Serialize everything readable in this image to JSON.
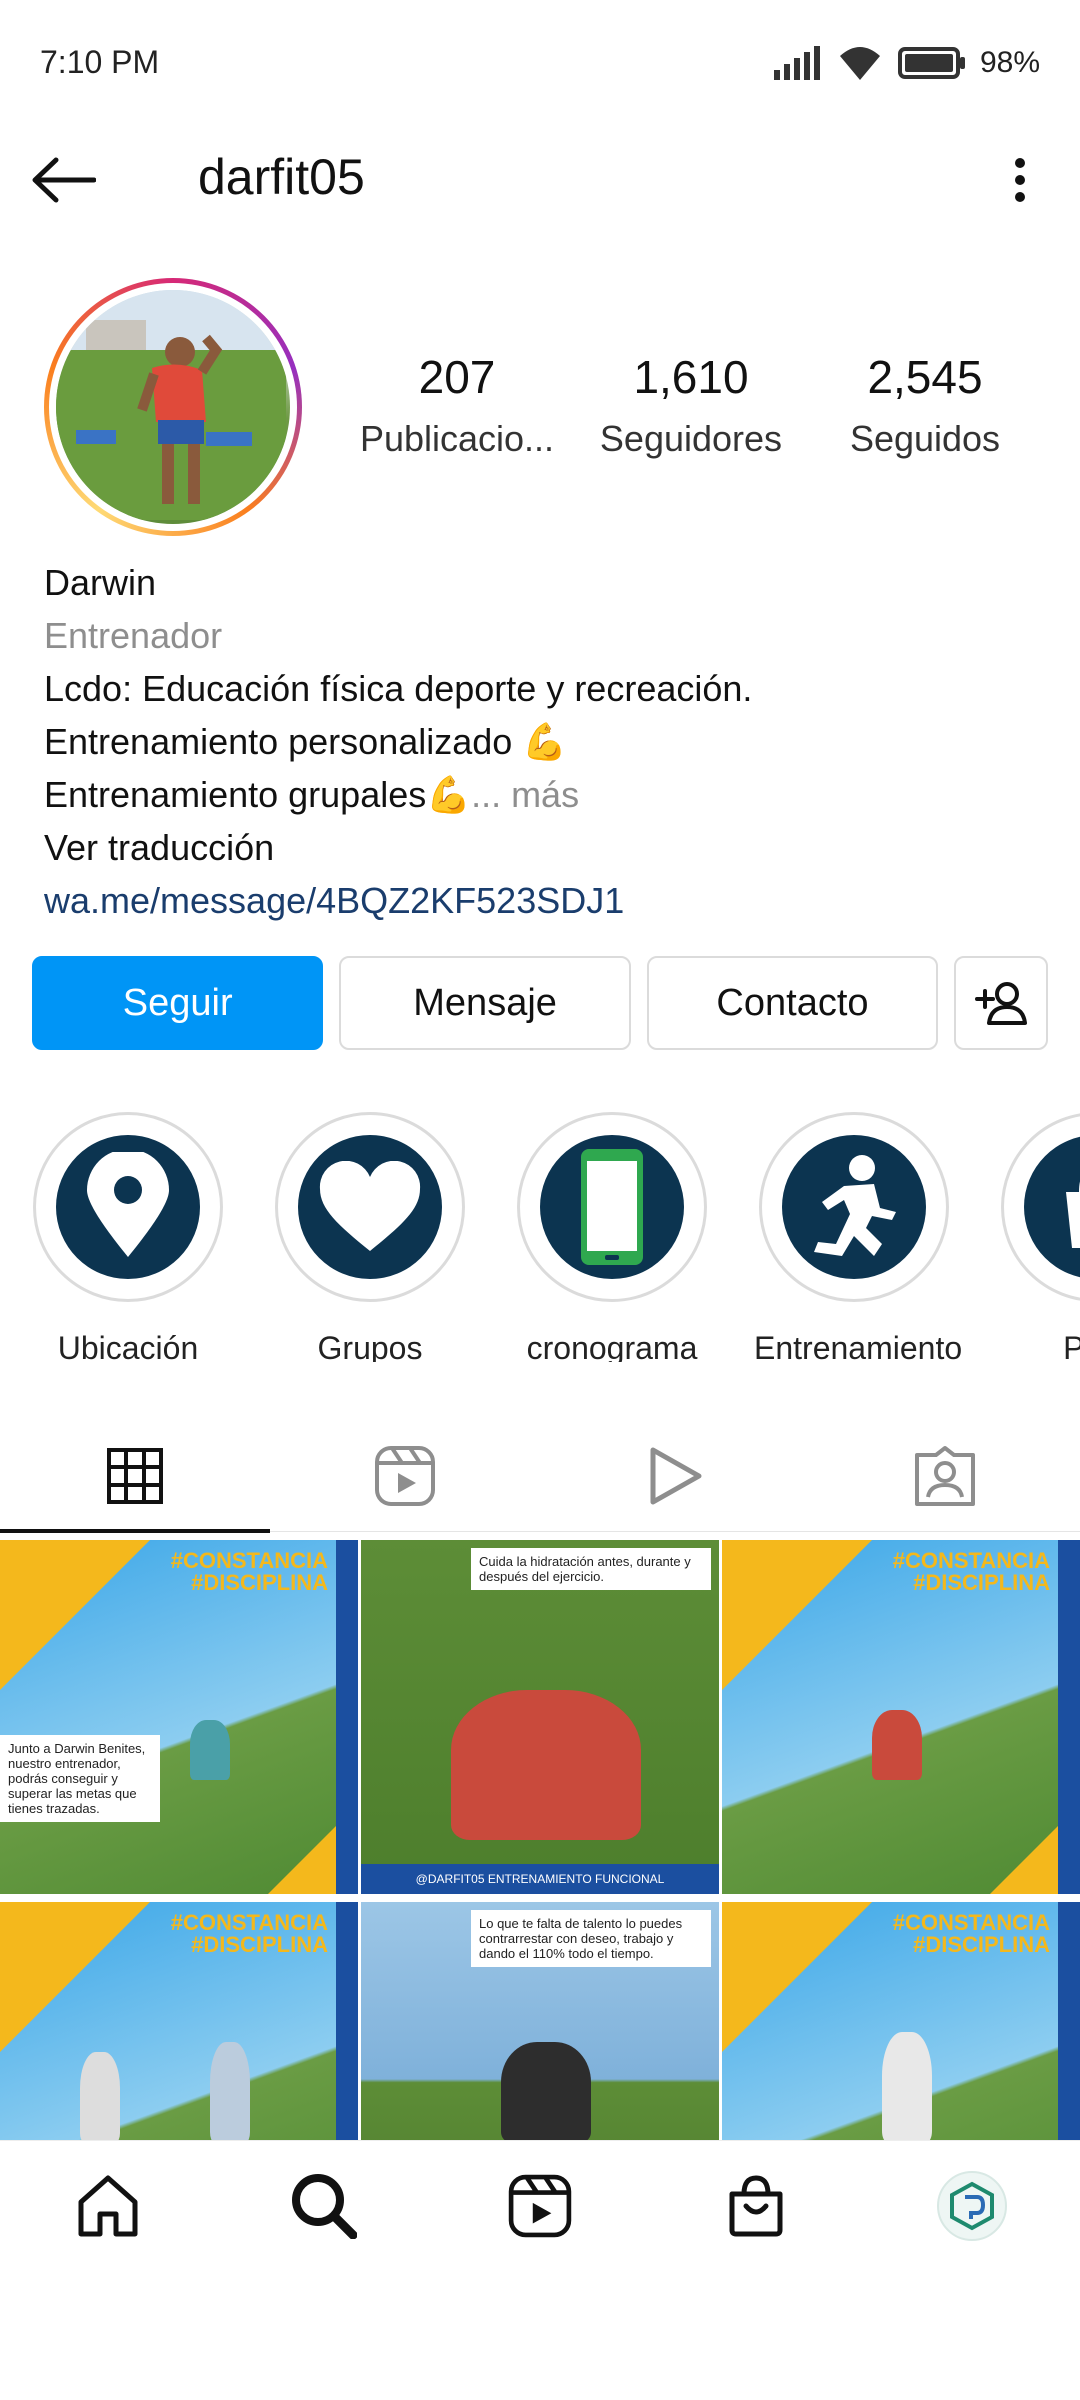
{
  "status_bar": {
    "time": "7:10 PM",
    "battery": "98%"
  },
  "header": {
    "username": "darfit05"
  },
  "profile": {
    "stats": [
      {
        "value": "207",
        "label": "Publicacio..."
      },
      {
        "value": "1,610",
        "label": "Seguidores"
      },
      {
        "value": "2,545",
        "label": "Seguidos"
      }
    ],
    "name": "Darwin",
    "category": "Entrenador",
    "bio_lines": [
      "Lcdo: Educación física deporte y recreación.",
      "Entrenamiento personalizado 💪",
      "Entrenamiento grupales💪"
    ],
    "more": "... más",
    "translate": "Ver traducción",
    "link": "wa.me/message/4BQZ2KF523SDJ1"
  },
  "actions": {
    "follow": "Seguir",
    "message": "Mensaje",
    "contact": "Contacto"
  },
  "highlights": [
    {
      "label": "Ubicación",
      "icon": "location-pin-icon"
    },
    {
      "label": "Grupos",
      "icon": "heart-icon"
    },
    {
      "label": "cronograma",
      "icon": "phone-icon"
    },
    {
      "label": "Entrenamiento",
      "icon": "runner-icon"
    },
    {
      "label": "Proc",
      "icon": "shopping-icon"
    }
  ],
  "tabs": [
    "grid-icon",
    "reels-icon",
    "video-play-icon",
    "tagged-icon"
  ],
  "posts": {
    "tag": "#CONSTANCIA #DISCIPLINA",
    "notes": [
      "Junto a Darwin Benites, nuestro entrenador, podrás conseguir y superar las metas que tienes trazadas.",
      "Cuida la hidratación antes, durante y después del ejercicio.",
      "Lo que te falta de talento lo puedes contrarrestar con deseo, trabajo y dando el 110% todo el tiempo."
    ],
    "footer": "@DARFIT05 ENTRENAMIENTO FUNCIONAL"
  },
  "bottom_nav": [
    "home-icon",
    "search-icon",
    "reels-icon",
    "shop-icon",
    "profile-avatar"
  ],
  "colors": {
    "accent": "#0095f6",
    "highlight_bg": "#0c3450",
    "link": "#1a3d6d"
  }
}
